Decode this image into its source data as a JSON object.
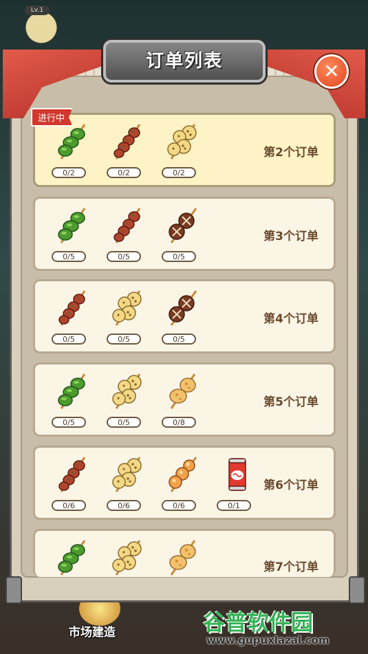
{
  "background": {
    "level_badge": "Lv.1",
    "bottom_button": "市场建造"
  },
  "title": "订单列表",
  "close_glyph": "✕",
  "active_tag": "进行中",
  "orders": [
    {
      "label": "第2个订单",
      "active": true,
      "items": [
        {
          "icon": "pepper-skewer-icon",
          "count": "0/2"
        },
        {
          "icon": "meat-skewer-icon",
          "count": "0/2"
        },
        {
          "icon": "lotus-skewer-icon",
          "count": "0/2"
        }
      ]
    },
    {
      "label": "第3个订单",
      "active": false,
      "items": [
        {
          "icon": "pepper-skewer-icon",
          "count": "0/5"
        },
        {
          "icon": "meat-skewer-icon",
          "count": "0/5"
        },
        {
          "icon": "mushroom-skewer-icon",
          "count": "0/5"
        }
      ]
    },
    {
      "label": "第4个订单",
      "active": false,
      "items": [
        {
          "icon": "meat-skewer-icon",
          "count": "0/5"
        },
        {
          "icon": "lotus-skewer-icon",
          "count": "0/5"
        },
        {
          "icon": "mushroom-skewer-icon",
          "count": "0/5"
        }
      ]
    },
    {
      "label": "第5个订单",
      "active": false,
      "items": [
        {
          "icon": "pepper-skewer-icon",
          "count": "0/5"
        },
        {
          "icon": "lotus-skewer-icon",
          "count": "0/5"
        },
        {
          "icon": "potato-skewer-icon",
          "count": "0/8"
        }
      ]
    },
    {
      "label": "第6个订单",
      "active": false,
      "items": [
        {
          "icon": "meat-skewer-icon",
          "count": "0/6"
        },
        {
          "icon": "lotus-skewer-icon",
          "count": "0/6"
        },
        {
          "icon": "fishball-skewer-icon",
          "count": "0/6"
        },
        {
          "icon": "cola-can-icon",
          "count": "0/1"
        }
      ]
    },
    {
      "label": "第7个订单",
      "active": false,
      "items": [
        {
          "icon": "pepper-skewer-icon",
          "count": ""
        },
        {
          "icon": "lotus-skewer-icon",
          "count": ""
        },
        {
          "icon": "potato-skewer-icon",
          "count": ""
        }
      ]
    }
  ],
  "watermark": {
    "text": "谷普软件园",
    "url": "www.gupuxlazal.com"
  }
}
